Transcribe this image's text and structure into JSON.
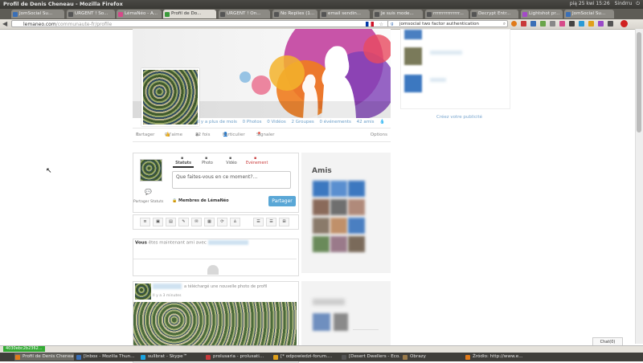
{
  "window": {
    "title": "Profil de Denis Cheneau - Mozilla Firefox"
  },
  "tray": {
    "datetime": "pią 25 kwi 15:26",
    "user": "Sindrru"
  },
  "browser_tabs": [
    {
      "label": "JomSocial Su...",
      "color": "#3a6fb7"
    },
    {
      "label": "URGENT ! So...",
      "color": "#555555"
    },
    {
      "label": "LémaNéo - A...",
      "color": "#d64a8a"
    },
    {
      "label": "Profil de Do...",
      "color": "#3a9a3a"
    },
    {
      "label": "URGENT ! On...",
      "color": "#555555"
    },
    {
      "label": "No Replies (1...",
      "color": "#555555"
    },
    {
      "label": "email sendin...",
      "color": "#555555"
    },
    {
      "label": "Je suis mode...",
      "color": "#555555"
    },
    {
      "label": "rrrrrrrrrrrrrrr...",
      "color": "#555555"
    },
    {
      "label": "Decrypt Entr...",
      "color": "#555555"
    },
    {
      "label": "Lightshot pr...",
      "color": "#a44ac8"
    },
    {
      "label": "JomSocial Su...",
      "color": "#3a6fb7"
    }
  ],
  "address": {
    "host": "lemaneo.com",
    "path": "/communaute-fr/profile"
  },
  "search": {
    "value": "jomsocial two factor authentication"
  },
  "profile": {
    "stats": [
      "Il y a plus de mois",
      "0 Photos",
      "0 Vidéos",
      "2 Groupes",
      "0 événements",
      "42 amis"
    ],
    "actions": [
      "Partager",
      "0 J'aime",
      "22 fois",
      "Particulier",
      "Signaler"
    ],
    "options_label": "Options"
  },
  "composer": {
    "tabs": [
      "Statuts",
      "Photo",
      "Vidéo",
      "Evénement"
    ],
    "placeholder": "Que faites-vous en ce moment?...",
    "privacy": "Membres de LémaNéo",
    "share_button": "Partager",
    "share_status": "Partager Statuts"
  },
  "toolbar_icons": [
    "list-icon",
    "image-icon",
    "video-icon",
    "pen-icon",
    "comment-icon",
    "calendar-icon",
    "refresh-icon",
    "user-icon",
    "list-icon",
    "list-icon",
    "grid-icon"
  ],
  "stream": {
    "you": "Vous",
    "text": "êtes maintenant ami avec"
  },
  "activity": {
    "text": "a téléchargé une nouvelle photo de profil",
    "time": "Il y a 3 minutes"
  },
  "sidebar": {
    "friends_title": "Amis",
    "ad_link": "Créez votre publicité"
  },
  "chat": {
    "label": "Chat(0)"
  },
  "status": {
    "id": "4030ebc2b2362..."
  },
  "taskbar": [
    {
      "label": "Profil de Denis Cheneau...",
      "color": "#e07a1a"
    },
    {
      "label": "[Inbox - Mozilla Thun...",
      "color": "#3a6fb7"
    },
    {
      "label": "sullbrat - Skype™",
      "color": "#1aa3e0"
    },
    {
      "label": "prolusaria - prolusati...",
      "color": "#c83a3a"
    },
    {
      "label": "[* odpowiedzi-forum....",
      "color": "#e0a01a"
    },
    {
      "label": "[Desert Dwellers - Eco...",
      "color": "#555555"
    },
    {
      "label": "Obrazy",
      "color": "#9a7a4a"
    },
    {
      "label": "Źródło: http://www.e...",
      "color": "#e07a1a"
    }
  ]
}
